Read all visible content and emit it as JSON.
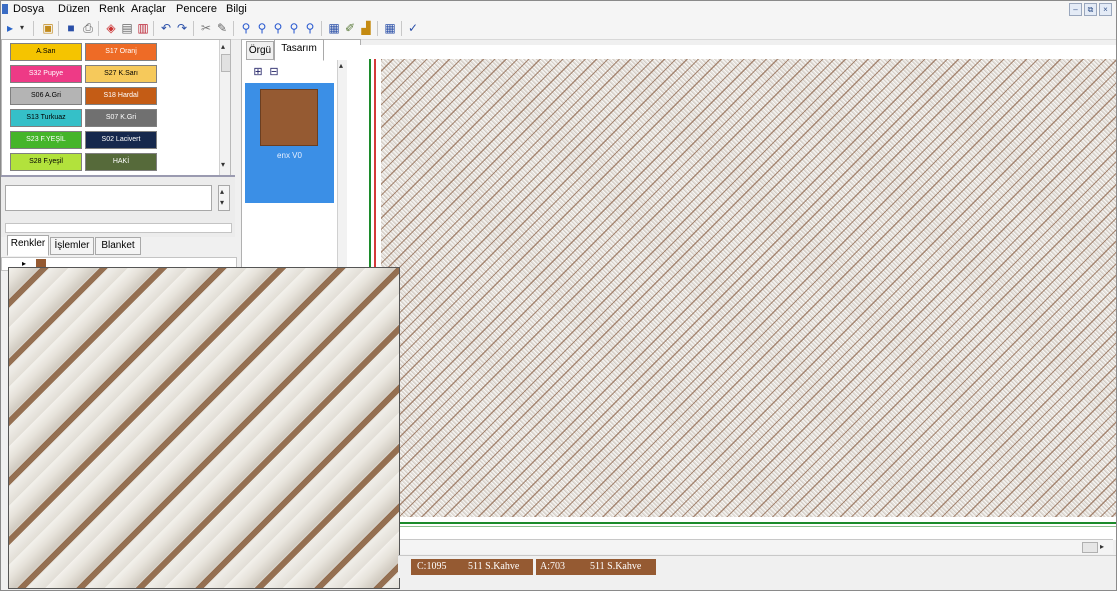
{
  "menu": {
    "items": [
      "Dosya",
      "Düzen",
      "Renk",
      "Araçlar",
      "Pencere",
      "Bilgi"
    ]
  },
  "window_controls": [
    "–",
    "⧉",
    "×"
  ],
  "toolbar": {
    "buttons": [
      "new-icon",
      "open-icon",
      "save-icon",
      "print-icon",
      "copy-icon",
      "paste-icon",
      "cut-icon",
      "undo-icon",
      "redo-icon",
      "tool-icon",
      "color-picker-icon",
      "zoom-in-icon",
      "zoom-out-icon",
      "zoom-fit-icon",
      "zoom-1-icon",
      "zoom-2-icon",
      "page-icon",
      "edit-icon",
      "chart-icon",
      "grid-icon",
      "spellcheck-icon"
    ]
  },
  "palette": {
    "colors": [
      {
        "label": "A.Sarı",
        "bg": "#f5c400",
        "fg": "#000000"
      },
      {
        "label": "S17 Oranj",
        "bg": "#ee6b26",
        "fg": "#ffffff"
      },
      {
        "label": "S32 Pupye",
        "bg": "#ee3a86",
        "fg": "#ffffff"
      },
      {
        "label": "S27 K.Sarı",
        "bg": "#f6c95b",
        "fg": "#000000"
      },
      {
        "label": "S06 A.Gri",
        "bg": "#b4b4b4",
        "fg": "#000000"
      },
      {
        "label": "S18 Hardal",
        "bg": "#c45c15",
        "fg": "#ffffff"
      },
      {
        "label": "S13 Turkuaz",
        "bg": "#35c0c8",
        "fg": "#000000"
      },
      {
        "label": "S07 K.Gri",
        "bg": "#707070",
        "fg": "#ffffff"
      },
      {
        "label": "S23 F.YEŞİL",
        "bg": "#45b52a",
        "fg": "#ffffff"
      },
      {
        "label": "S02 Lacivert",
        "bg": "#16284d",
        "fg": "#ffffff"
      },
      {
        "label": "S28 F.yeşil",
        "bg": "#b2e23c",
        "fg": "#000000"
      },
      {
        "label": "HAKİ",
        "bg": "#566a3a",
        "fg": "#ffffff"
      }
    ]
  },
  "lower_tabs": {
    "items": [
      "Renkler",
      "İşlemler",
      "Blanket"
    ]
  },
  "mid_panel": {
    "tabs": [
      "Örgü",
      "Tasarım"
    ],
    "pattern_item_label": "enx V0",
    "pattern_color": "#955a32"
  },
  "status": {
    "cell1": {
      "count": "C:1095",
      "color_name": "511 S.Kahve"
    },
    "cell2": {
      "count": "A:703",
      "color_name": "511 S.Kahve"
    }
  }
}
